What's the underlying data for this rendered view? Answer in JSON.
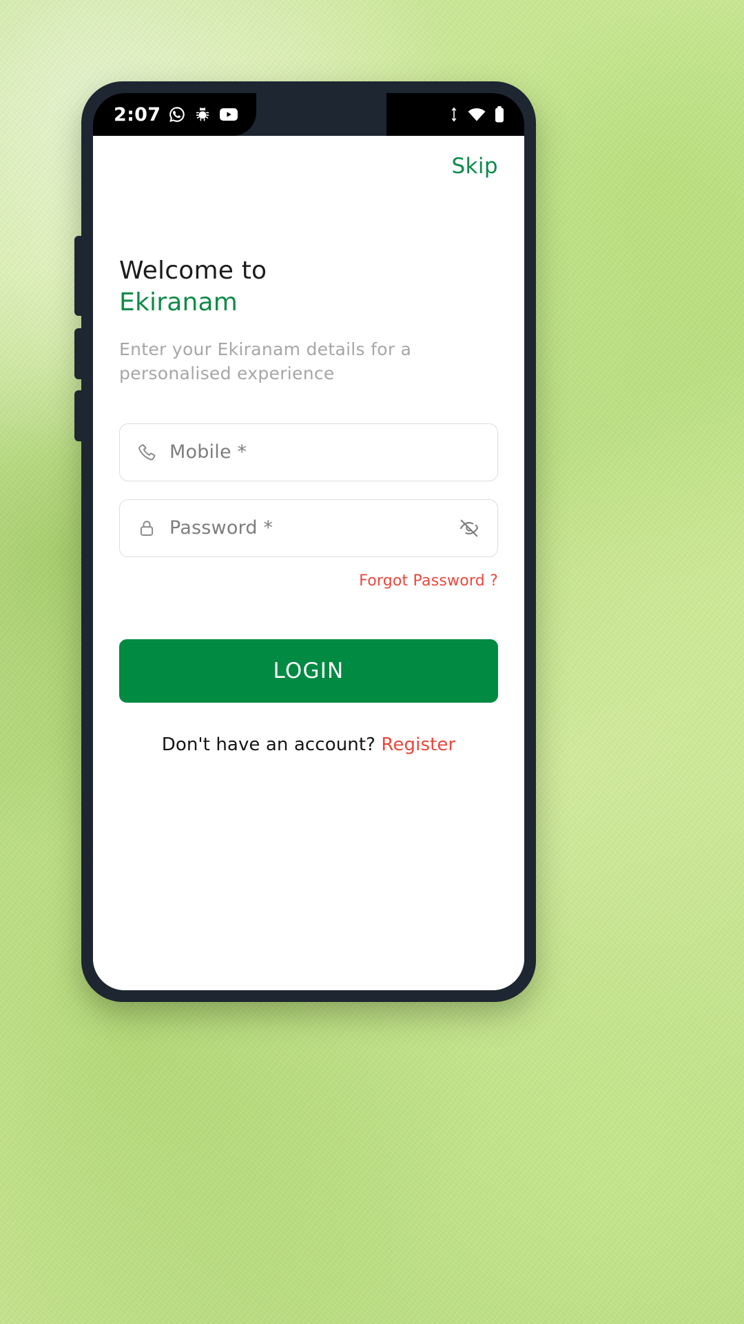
{
  "device": {
    "side_buttons": [
      "mute-switch",
      "volume-up",
      "volume-down"
    ]
  },
  "status_bar": {
    "clock": "2:07",
    "left_icons": [
      "whatsapp-icon",
      "android-debug-icon",
      "youtube-icon"
    ],
    "right_icons": [
      "mobile-data-icon",
      "wifi-icon",
      "battery-icon"
    ]
  },
  "screen": {
    "skip_label": "Skip",
    "welcome": {
      "title": "Welcome to",
      "brand": "Ekiranam",
      "subtitle": "Enter your Ekiranam details for a personalised experience"
    },
    "form": {
      "mobile": {
        "placeholder": "Mobile *",
        "value": "",
        "icon": "phone-icon"
      },
      "password": {
        "placeholder": "Password *",
        "value": "",
        "icon": "lock-icon",
        "toggle_icon": "eye-off-icon"
      },
      "forgot_password_label": "Forgot Password ?",
      "login_label": "LOGIN"
    },
    "register": {
      "prompt": "Don't have an account? ",
      "link": "Register"
    }
  },
  "colors": {
    "brand_green": "#0f8a46",
    "button_green": "#018a42",
    "accent_red": "#e8483c",
    "placeholder_gray": "#7d7d7d",
    "subtitle_gray": "#a6a6a6",
    "device_frame": "#1e2631",
    "background_green": "#c2e08c"
  }
}
